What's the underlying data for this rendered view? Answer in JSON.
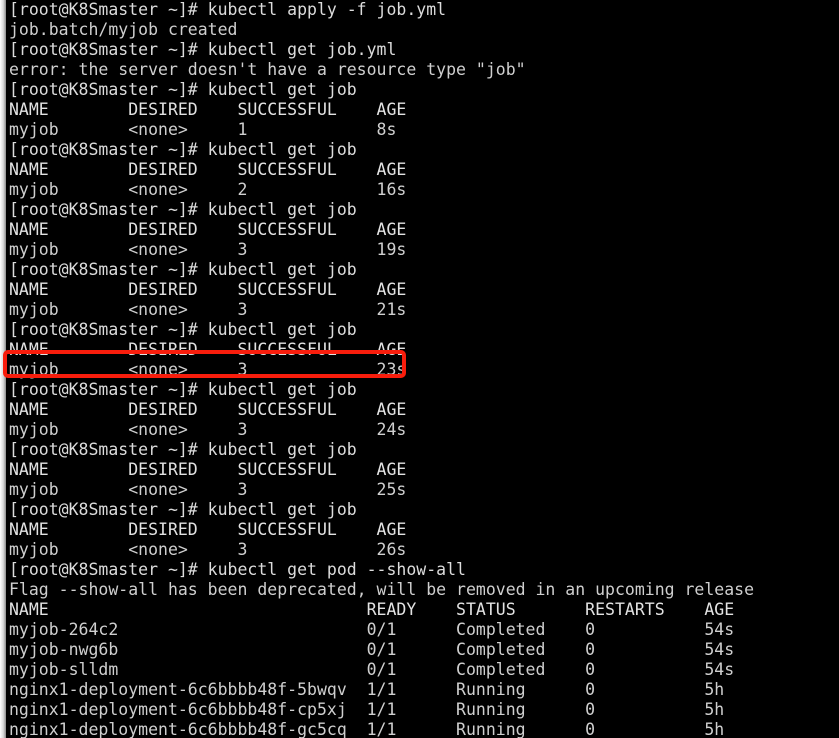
{
  "terminal": {
    "prompt": "[root@K8Smaster ~]# ",
    "text_color": "#d6d6d6",
    "background_color": "#000000",
    "highlight_color": "#f81d0c",
    "lines": [
      "[root@K8Smaster ~]# kubectl apply -f job.yml",
      "job.batch/myjob created",
      "[root@K8Smaster ~]# kubectl get job.yml",
      "error: the server doesn't have a resource type \"job\"",
      "[root@K8Smaster ~]# kubectl get job",
      "NAME        DESIRED    SUCCESSFUL    AGE",
      "myjob       <none>     1             8s",
      "[root@K8Smaster ~]# kubectl get job",
      "NAME        DESIRED    SUCCESSFUL    AGE",
      "myjob       <none>     2             16s",
      "[root@K8Smaster ~]# kubectl get job",
      "NAME        DESIRED    SUCCESSFUL    AGE",
      "myjob       <none>     3             19s",
      "[root@K8Smaster ~]# kubectl get job",
      "NAME        DESIRED    SUCCESSFUL    AGE",
      "myjob       <none>     3             21s",
      "[root@K8Smaster ~]# kubectl get job",
      "NAME        DESIRED    SUCCESSFUL    AGE",
      "myjob       <none>     3             23s",
      "[root@K8Smaster ~]# kubectl get job",
      "NAME        DESIRED    SUCCESSFUL    AGE",
      "myjob       <none>     3             24s",
      "[root@K8Smaster ~]# kubectl get job",
      "NAME        DESIRED    SUCCESSFUL    AGE",
      "myjob       <none>     3             25s",
      "[root@K8Smaster ~]# kubectl get job",
      "NAME        DESIRED    SUCCESSFUL    AGE",
      "myjob       <none>     3             26s",
      "[root@K8Smaster ~]# kubectl get pod --show-all",
      "Flag --show-all has been deprecated, will be removed in an upcoming release",
      "NAME                                READY    STATUS       RESTARTS    AGE",
      "myjob-264c2                         0/1      Completed    0           54s",
      "myjob-nwg6b                         0/1      Completed    0           54s",
      "myjob-slldm                         0/1      Completed    0           54s",
      "nginx1-deployment-6c6bbbb48f-5bwqv  1/1      Running      0           5h",
      "nginx1-deployment-6c6bbbb48f-cp5xj  1/1      Running      0           5h",
      "nginx1-deployment-6c6bbbb48f-gc5cq  1/1      Running      0           5h"
    ],
    "line_kinds": [
      "prompt",
      "output",
      "prompt",
      "output",
      "prompt",
      "header",
      "output",
      "prompt",
      "header",
      "output",
      "prompt",
      "header",
      "output",
      "prompt",
      "header",
      "output",
      "prompt",
      "header",
      "output",
      "prompt",
      "header",
      "output",
      "prompt",
      "header",
      "output",
      "prompt",
      "header",
      "output",
      "prompt",
      "output",
      "header",
      "output",
      "output",
      "output",
      "output",
      "output",
      "output"
    ],
    "commands": [
      "kubectl apply -f job.yml",
      "kubectl get job.yml",
      "kubectl get job",
      "kubectl get pod --show-all"
    ],
    "job_table": {
      "columns": [
        "NAME",
        "DESIRED",
        "SUCCESSFUL",
        "AGE"
      ],
      "samples": [
        {
          "name": "myjob",
          "desired": "<none>",
          "successful": "1",
          "age": "8s"
        },
        {
          "name": "myjob",
          "desired": "<none>",
          "successful": "2",
          "age": "16s"
        },
        {
          "name": "myjob",
          "desired": "<none>",
          "successful": "3",
          "age": "19s"
        },
        {
          "name": "myjob",
          "desired": "<none>",
          "successful": "3",
          "age": "21s"
        },
        {
          "name": "myjob",
          "desired": "<none>",
          "successful": "3",
          "age": "23s"
        },
        {
          "name": "myjob",
          "desired": "<none>",
          "successful": "3",
          "age": "24s"
        },
        {
          "name": "myjob",
          "desired": "<none>",
          "successful": "3",
          "age": "25s"
        },
        {
          "name": "myjob",
          "desired": "<none>",
          "successful": "3",
          "age": "26s"
        }
      ]
    },
    "pod_table": {
      "columns": [
        "NAME",
        "READY",
        "STATUS",
        "RESTARTS",
        "AGE"
      ],
      "rows": [
        {
          "name": "myjob-264c2",
          "ready": "0/1",
          "status": "Completed",
          "restarts": "0",
          "age": "54s"
        },
        {
          "name": "myjob-nwg6b",
          "ready": "0/1",
          "status": "Completed",
          "restarts": "0",
          "age": "54s"
        },
        {
          "name": "myjob-slldm",
          "ready": "0/1",
          "status": "Completed",
          "restarts": "0",
          "age": "54s"
        },
        {
          "name": "nginx1-deployment-6c6bbbb48f-5bwqv",
          "ready": "1/1",
          "status": "Running",
          "restarts": "0",
          "age": "5h"
        },
        {
          "name": "nginx1-deployment-6c6bbbb48f-cp5xj",
          "ready": "1/1",
          "status": "Running",
          "restarts": "0",
          "age": "5h"
        },
        {
          "name": "nginx1-deployment-6c6bbbb48f-gc5cq",
          "ready": "1/1",
          "status": "Running",
          "restarts": "0",
          "age": "5h"
        }
      ]
    },
    "messages": {
      "created": "job.batch/myjob created",
      "error": "error: the server doesn't have a resource type \"job\"",
      "deprecation": "Flag --show-all has been deprecated, will be removed in an upcoming release"
    },
    "annotation": {
      "label": "highlight-rectangle",
      "target_line_index": 18,
      "target_text": "myjob       <none>     3             23s"
    }
  }
}
